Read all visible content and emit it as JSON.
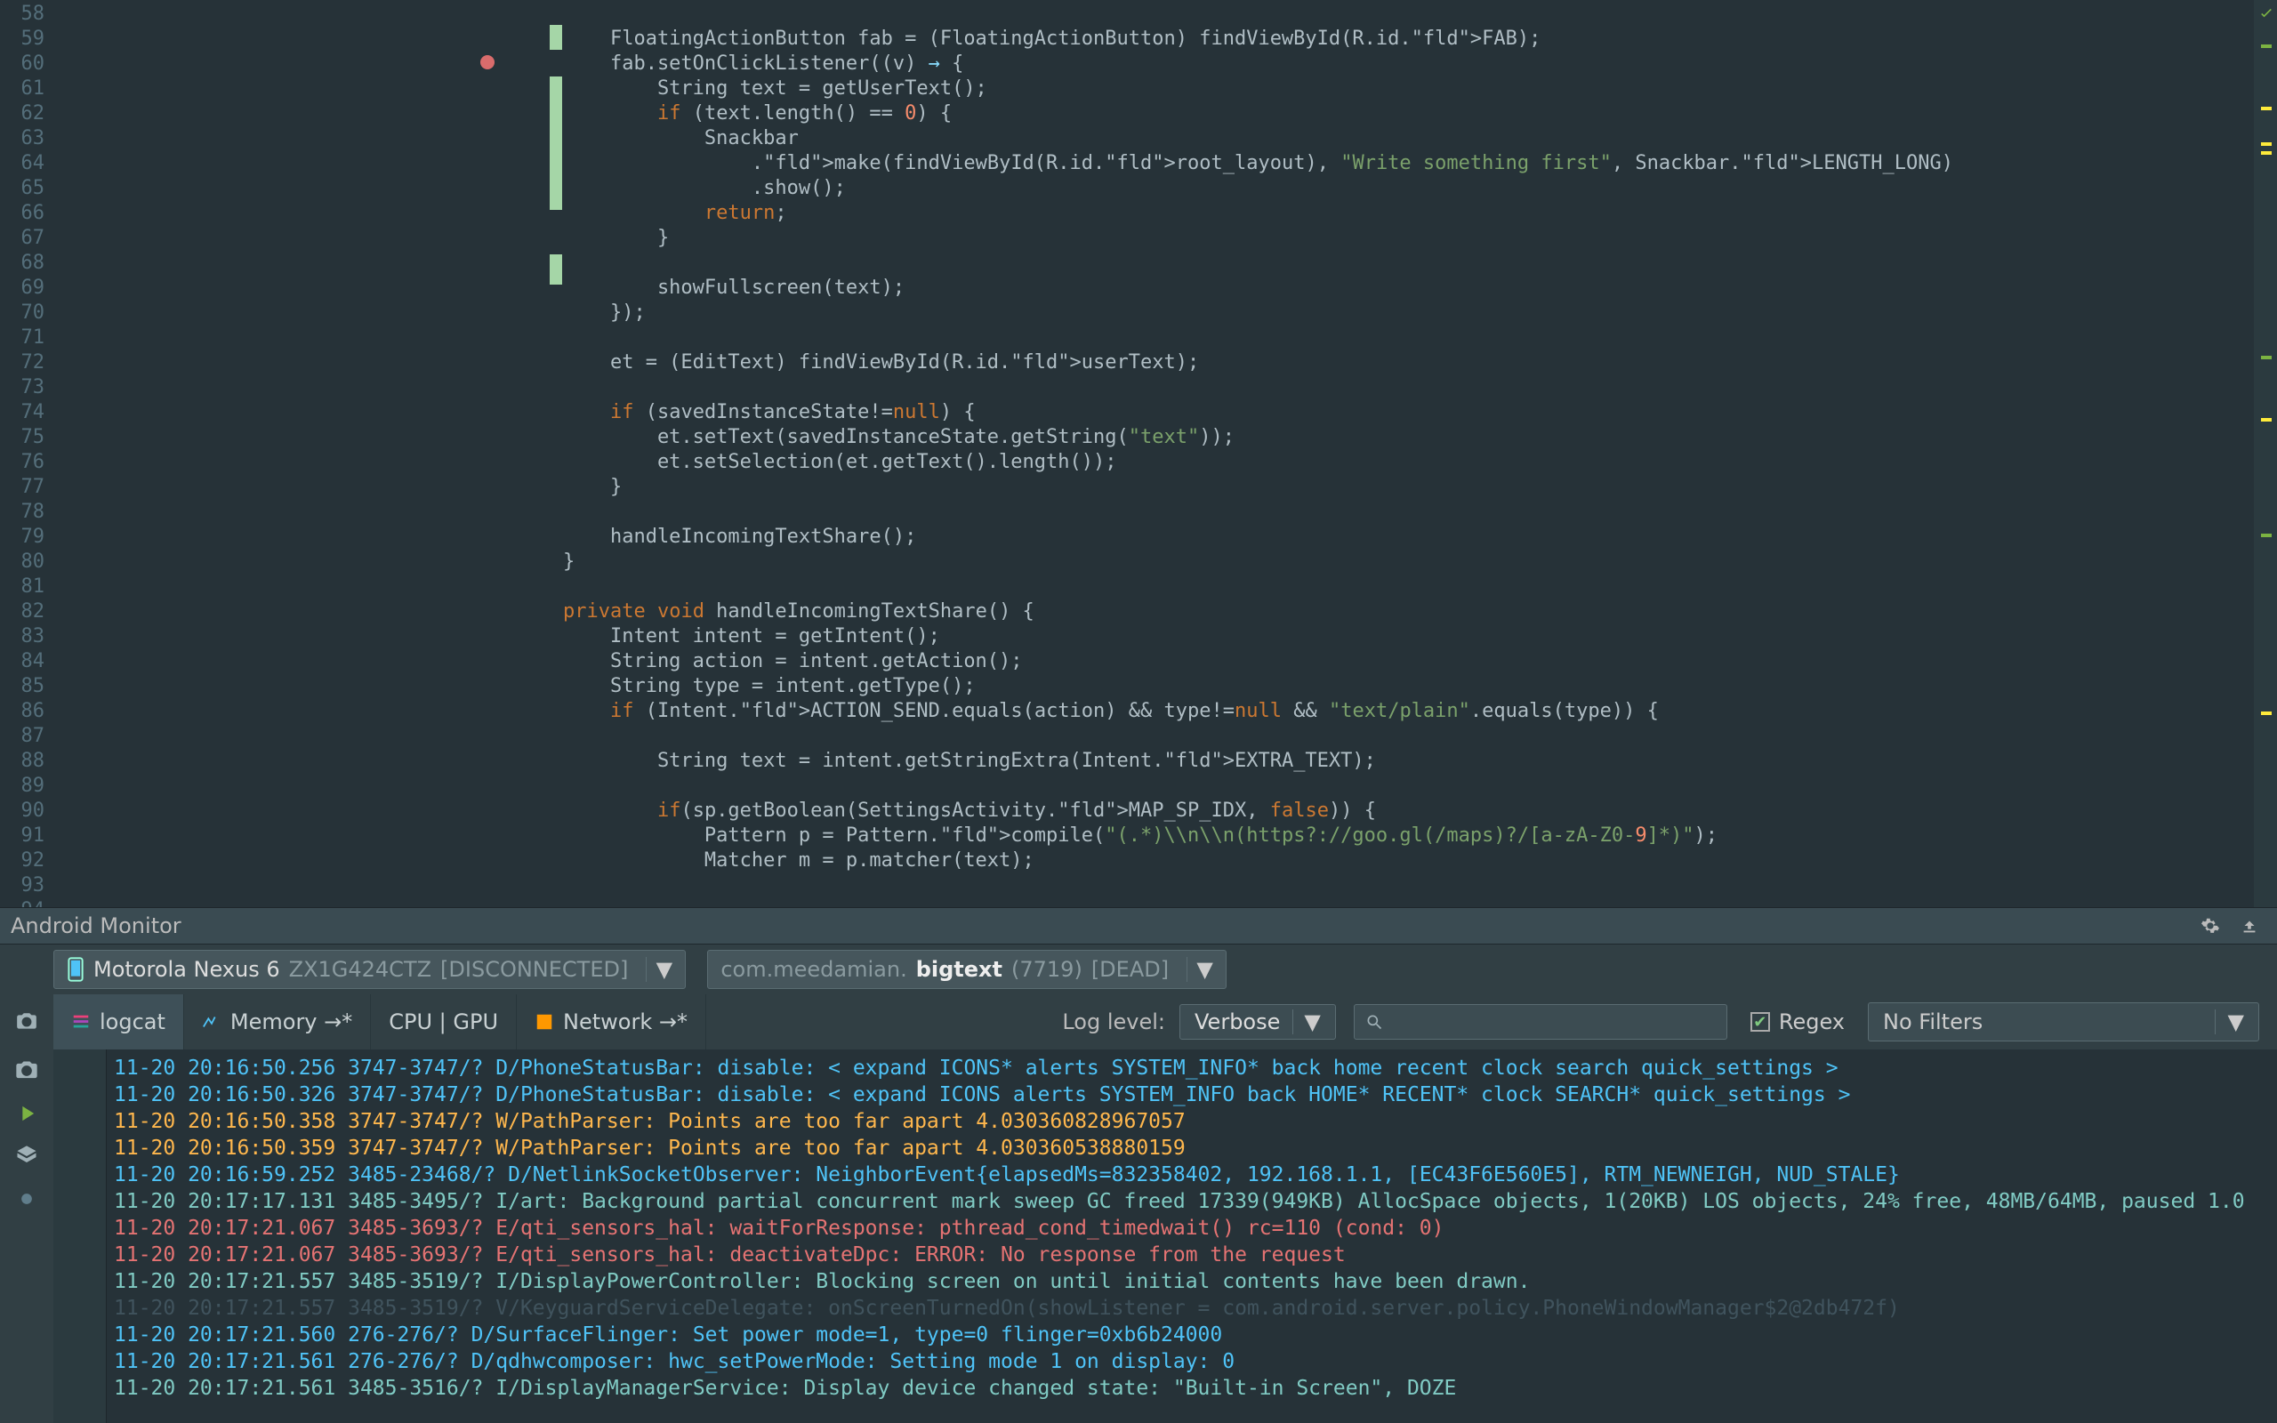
{
  "editor": {
    "first_line_no": 58,
    "lines": [
      "",
      "        FloatingActionButton fab = (FloatingActionButton) findViewById(R.id.|FAB|);",
      "        fab.setOnClickListener((v) → {",
      "            String text = getUserText();",
      "            if (text.length() == 0) {",
      "                Snackbar",
      "                    .|make|(findViewById(R.id.|root_layout|), \"Write something first\", Snackbar.|LENGTH_LONG|)",
      "                    .show();",
      "                return;",
      "            }",
      "",
      "            showFullscreen(text);",
      "        });",
      "",
      "        et = (EditText) findViewById(R.id.|userText|);",
      "",
      "        if (savedInstanceState!=null) {",
      "            et.setText(savedInstanceState.getString(\"text\"));",
      "            et.setSelection(et.getText().length());",
      "        }",
      "",
      "        handleIncomingTextShare();",
      "    }",
      "",
      "    private void handleIncomingTextShare() {",
      "        Intent intent = getIntent();",
      "        String action = intent.getAction();",
      "        String type = intent.getType();",
      "        if (Intent.|ACTION_SEND|.equals(action) && type!=null && \"text/plain\".equals(type)) {",
      "",
      "            String text = intent.getStringExtra(Intent.|EXTRA_TEXT|);",
      "",
      "            if(sp.getBoolean(SettingsActivity.|MAP_SP_IDX|, false)) {",
      "                Pattern p = Pattern.|compile|(\"(.*)\\\\n\\\\n(https?://goo.gl(/maps)?/[a-zA-Z0-9]*)\");",
      "                Matcher m = p.matcher(text);",
      "",
      ""
    ]
  },
  "panel": {
    "title": "Android Monitor",
    "settings_icon": "gear-icon",
    "download_icon": "download-icon"
  },
  "device": {
    "icon": "phone-icon",
    "name": "Motorola Nexus 6",
    "serial": "ZX1G424CTZ",
    "state": "[DISCONNECTED]"
  },
  "process": {
    "package_prefix": "com.meedamian.",
    "package_bold": "bigtext",
    "pid": "(7719)",
    "state": "[DEAD]"
  },
  "tabs": {
    "items": [
      {
        "id": "logcat",
        "label": "logcat",
        "icon": "logcat-icon"
      },
      {
        "id": "memory",
        "label": "Memory →*",
        "icon": "memory-icon"
      },
      {
        "id": "cpu",
        "label": "CPU | GPU",
        "icon": ""
      },
      {
        "id": "network",
        "label": "Network →*",
        "icon": "network-icon"
      }
    ],
    "active": "logcat"
  },
  "loglevel": {
    "label": "Log level:",
    "value": "Verbose"
  },
  "search": {
    "placeholder": ""
  },
  "regex": {
    "label": "Regex",
    "checked": true
  },
  "filter": {
    "value": "No Filters"
  },
  "log_toolbar_left": [
    "camera-icon",
    "play-icon",
    "layers-icon",
    "dot-icon"
  ],
  "log_toolbar_inner": [
    "trash-icon",
    "scroll-end-icon",
    "arrow-up-icon",
    "arrow-down-icon",
    "settings-icon",
    "print-icon",
    "restart-icon",
    "more-icon"
  ],
  "log": [
    {
      "lv": "D",
      "txt": "11-20 20:16:50.256 3747-3747/? D/PhoneStatusBar: disable: < expand ICONS* alerts SYSTEM_INFO* back home recent clock search quick_settings >"
    },
    {
      "lv": "D",
      "txt": "11-20 20:16:50.326 3747-3747/? D/PhoneStatusBar: disable: < expand ICONS alerts SYSTEM_INFO back HOME* RECENT* clock SEARCH* quick_settings >"
    },
    {
      "lv": "W",
      "txt": "11-20 20:16:50.358 3747-3747/? W/PathParser: Points are too far apart 4.030360828967057"
    },
    {
      "lv": "W",
      "txt": "11-20 20:16:50.359 3747-3747/? W/PathParser: Points are too far apart 4.030360538880159"
    },
    {
      "lv": "D",
      "txt": "11-20 20:16:59.252 3485-23468/? D/NetlinkSocketObserver: NeighborEvent{elapsedMs=832358402, 192.168.1.1, [EC43F6E560E5], RTM_NEWNEIGH, NUD_STALE}"
    },
    {
      "lv": "I",
      "txt": "11-20 20:17:17.131 3485-3495/? I/art: Background partial concurrent mark sweep GC freed 17339(949KB) AllocSpace objects, 1(20KB) LOS objects, 24% free, 48MB/64MB, paused 1.0"
    },
    {
      "lv": "E",
      "txt": "11-20 20:17:21.067 3485-3693/? E/qti_sensors_hal: waitForResponse: pthread_cond_timedwait() rc=110 (cond: 0)"
    },
    {
      "lv": "E",
      "txt": "11-20 20:17:21.067 3485-3693/? E/qti_sensors_hal: deactivateDpc: ERROR: No response from the request"
    },
    {
      "lv": "I",
      "txt": "11-20 20:17:21.557 3485-3519/? I/DisplayPowerController: Blocking screen on until initial contents have been drawn."
    },
    {
      "lv": "V",
      "txt": "11-20 20:17:21.557 3485-3519/? V/KeyguardServiceDelegate: onScreenTurnedOn(showListener = com.android.server.policy.PhoneWindowManager$2@2db472f)",
      "fade": true
    },
    {
      "lv": "D",
      "txt": "11-20 20:17:21.560 276-276/? D/SurfaceFlinger: Set power mode=1, type=0 flinger=0xb6b24000"
    },
    {
      "lv": "D",
      "txt": "11-20 20:17:21.561 276-276/? D/qdhwcomposer: hwc_setPowerMode: Setting mode 1 on display: 0"
    },
    {
      "lv": "I",
      "txt": "11-20 20:17:21.561 3485-3516/? I/DisplayManagerService: Display device changed state: \"Built-in Screen\", DOZE"
    }
  ]
}
